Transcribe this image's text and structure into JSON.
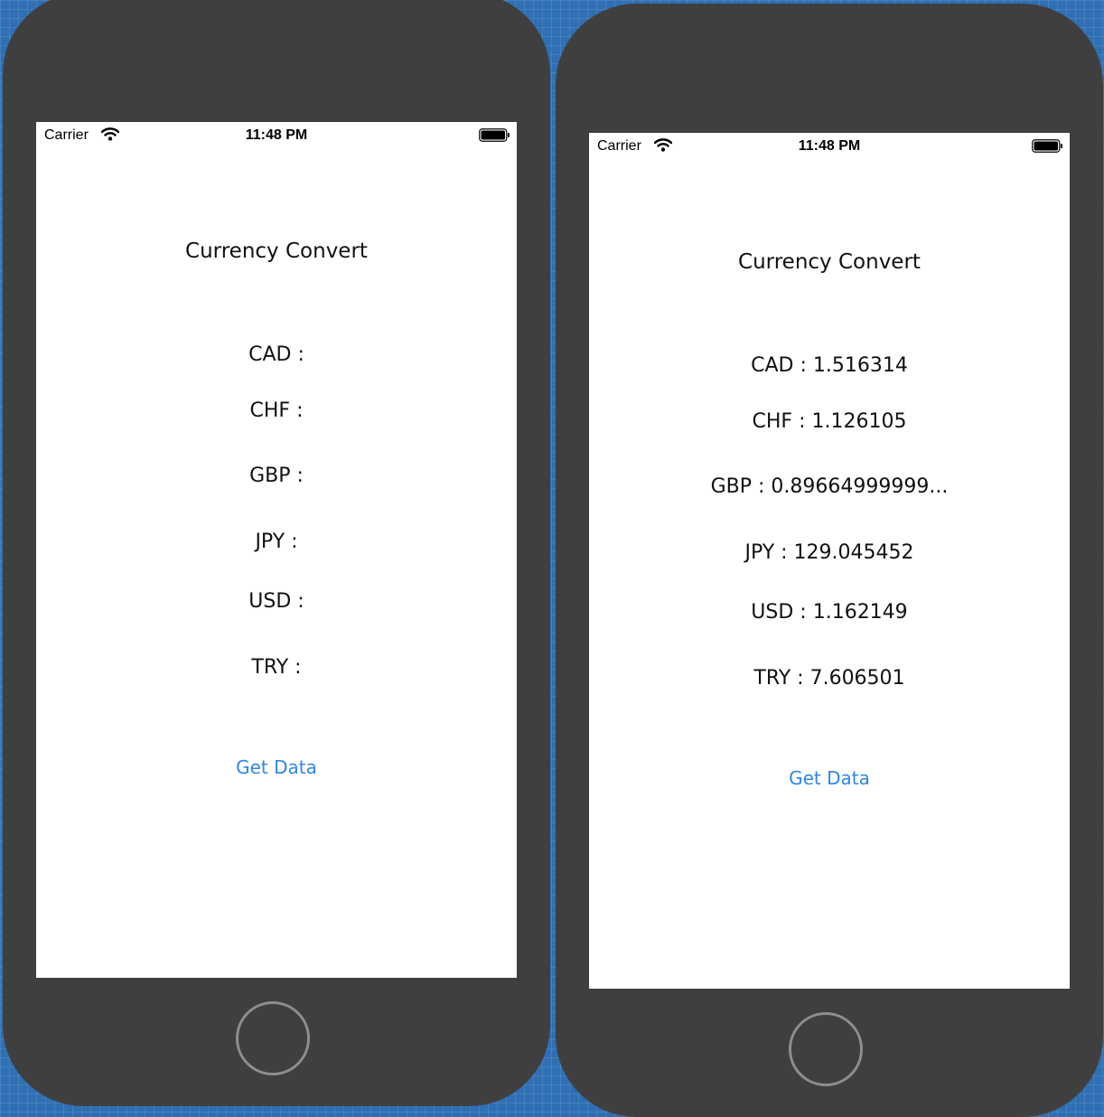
{
  "colors": {
    "background": "#2f6fb3",
    "device_body": "#3f3f3f",
    "screen": "#ffffff",
    "link": "#2f86e8",
    "home_ring": "#8e8e8e"
  },
  "icons": {
    "signal": "wifi-icon",
    "battery": "battery-icon",
    "home": "home-button"
  },
  "simulators": [
    {
      "status_bar": {
        "carrier": "Carrier",
        "time": "11:48 PM"
      },
      "title": "Currency Convert",
      "rates": [
        {
          "label": "CAD :"
        },
        {
          "label": "CHF :"
        },
        {
          "label": "GBP :"
        },
        {
          "label": "JPY :"
        },
        {
          "label": "USD :"
        },
        {
          "label": "TRY :"
        }
      ],
      "button_label": "Get Data"
    },
    {
      "status_bar": {
        "carrier": "Carrier",
        "time": "11:48 PM"
      },
      "title": "Currency Convert",
      "rates": [
        {
          "label": "CAD : 1.516314"
        },
        {
          "label": "CHF : 1.126105"
        },
        {
          "label": "GBP : 0.89664999999..."
        },
        {
          "label": "JPY : 129.045452"
        },
        {
          "label": "USD : 1.162149"
        },
        {
          "label": "TRY : 7.606501"
        }
      ],
      "button_label": "Get Data"
    }
  ]
}
